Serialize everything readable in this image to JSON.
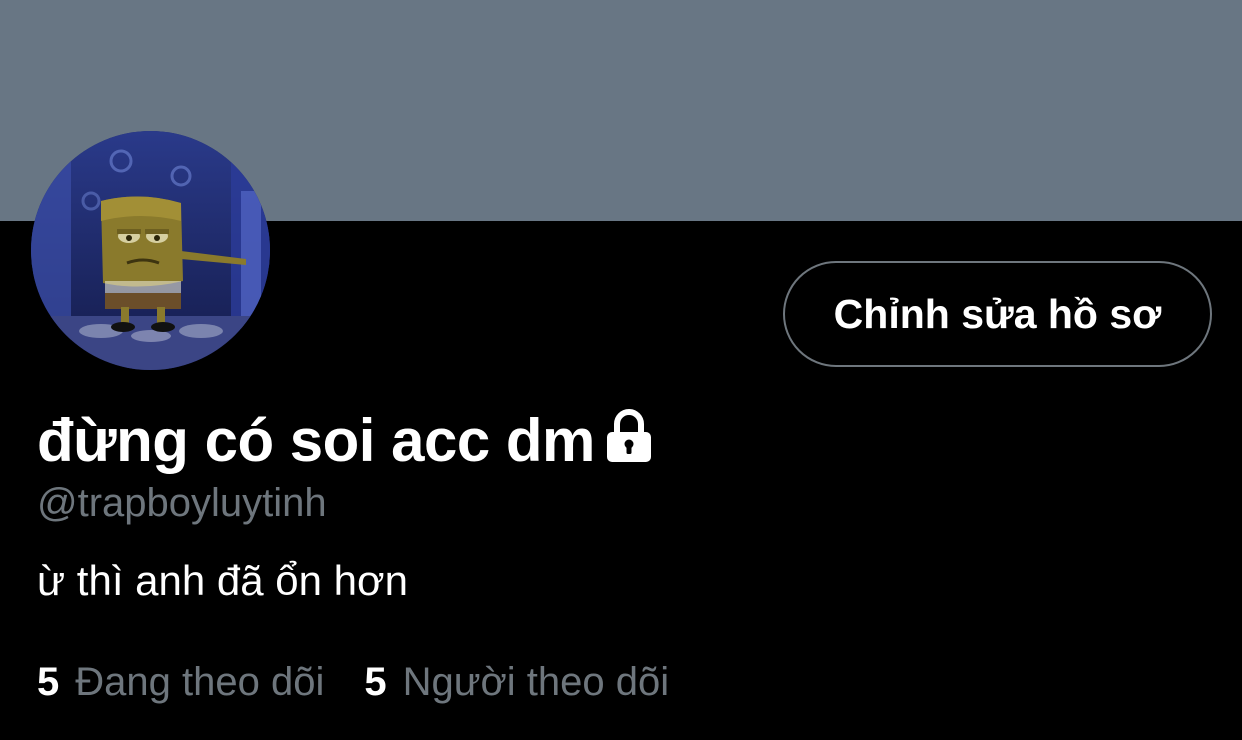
{
  "colors": {
    "banner": "#687684",
    "background": "#000000",
    "primary_text": "#ffffff",
    "secondary_text": "#6e767d",
    "button_border": "#6e767d"
  },
  "header": {
    "avatar_icon": "avatar-image"
  },
  "profile": {
    "edit_button_label": "Chỉnh sửa hồ sơ",
    "display_name": "đừng có soi acc dm",
    "protected_icon": "lock-icon",
    "handle": "@trapboyluytinh",
    "bio": "ừ thì anh đã ổn hơn"
  },
  "stats": {
    "following_count": "5",
    "following_label": "Đang theo dõi",
    "followers_count": "5",
    "followers_label": "Người theo dõi"
  }
}
